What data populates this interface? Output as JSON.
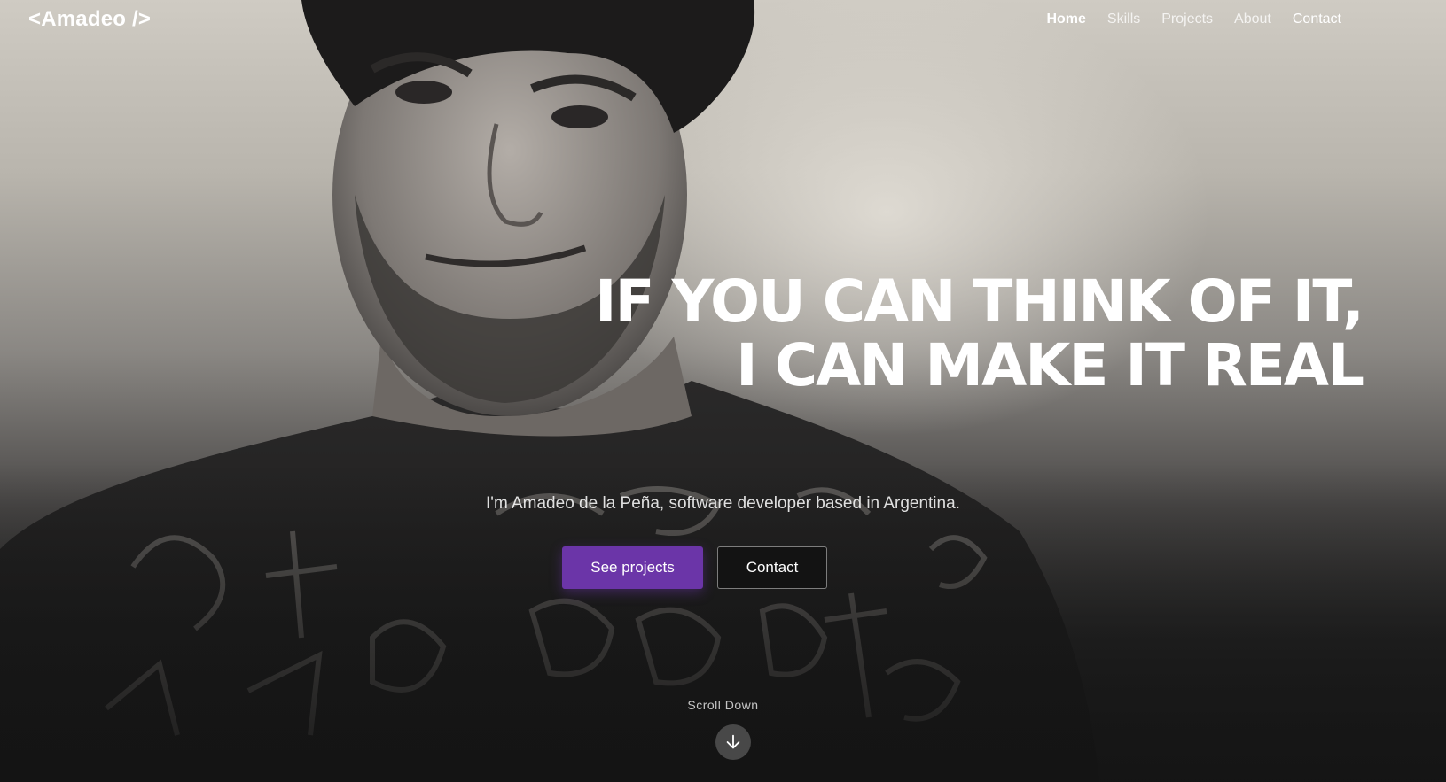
{
  "brand": {
    "logo_text": "<Amadeo />"
  },
  "nav": {
    "items": [
      {
        "label": "Home",
        "active": true
      },
      {
        "label": "Skills",
        "active": false
      },
      {
        "label": "Projects",
        "active": false
      },
      {
        "label": "About",
        "active": false
      },
      {
        "label": "Contact",
        "active": false
      }
    ]
  },
  "hero": {
    "headline_line1": "IF YOU CAN THINK OF IT,",
    "headline_line2": "I CAN MAKE IT REAL",
    "intro": "I'm Amadeo de la Peña, software developer based in Argentina.",
    "primary_button": "See projects",
    "secondary_button": "Contact",
    "scroll_label": "Scroll Down",
    "scroll_icon": "arrow-down-icon"
  },
  "colors": {
    "accent": "#6b35a8",
    "text": "#ffffff"
  }
}
